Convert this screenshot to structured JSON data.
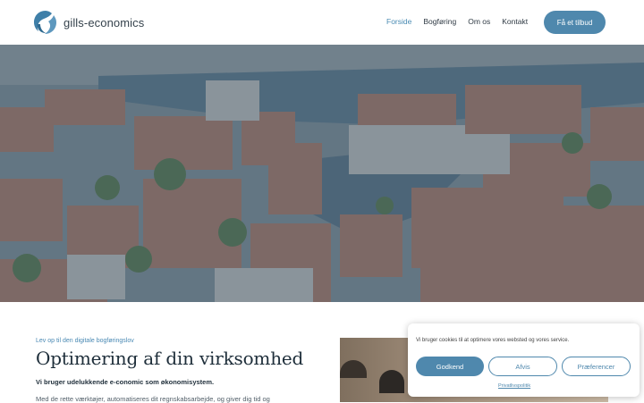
{
  "brand": {
    "name": "gills-economics"
  },
  "nav": {
    "items": [
      {
        "label": "Forside",
        "active": true
      },
      {
        "label": "Bogføring",
        "active": false
      },
      {
        "label": "Om os",
        "active": false
      },
      {
        "label": "Kontakt",
        "active": false
      }
    ],
    "cta_label": "Få et tilbud"
  },
  "hero": {
    "image": "aerial-city-harbour-photo"
  },
  "section": {
    "kicker": "Lev op til den digitale bogføringslov",
    "title": "Optimering af din virksomhed",
    "lead": "Vi bruger udelukkende e-conomic som økonomisystem.",
    "body": "Med de rette værktøjer, automatiseres dit regnskabsarbejde, og giver dig tid og"
  },
  "cookie": {
    "text": "Vi bruger cookies til at optimere vores websted og vores service.",
    "accept_label": "Godkend",
    "deny_label": "Afvis",
    "preferences_label": "Præferencer",
    "privacy_label": "Privatlivspolitik"
  },
  "colors": {
    "accent": "#4f88ad",
    "link": "#4a8bb3",
    "heading": "#1e2e3a"
  }
}
